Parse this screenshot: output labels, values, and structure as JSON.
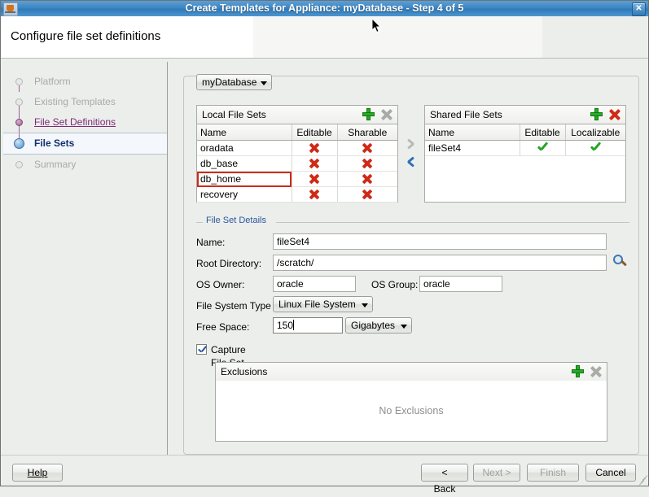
{
  "window": {
    "title": "Create Templates for Appliance: myDatabase - Step 4 of 5",
    "app_icon": "java-coffee-icon",
    "close_label": "✕"
  },
  "header": {
    "heading": "Configure file set definitions"
  },
  "sidebar": {
    "steps": [
      {
        "label": "Platform",
        "state": "disabled"
      },
      {
        "label": "Existing Templates",
        "state": "disabled"
      },
      {
        "label": "File Set Definitions",
        "state": "link"
      },
      {
        "label": "File Sets",
        "state": "active"
      },
      {
        "label": "Summary",
        "state": "disabled"
      }
    ]
  },
  "main": {
    "appliance_combo": {
      "value": "myDatabase"
    },
    "local_table": {
      "title": "Local File Sets",
      "add_icon": "plus-icon",
      "delete_icon": "delete-x-icon",
      "delete_enabled": "false",
      "columns": [
        "Name",
        "Editable",
        "Sharable"
      ],
      "rows": [
        {
          "name": "oradata",
          "editable": "x",
          "sharable": "x",
          "selected": "false"
        },
        {
          "name": "db_base",
          "editable": "x",
          "sharable": "x",
          "selected": "false"
        },
        {
          "name": "db_home",
          "editable": "x",
          "sharable": "x",
          "selected": "true"
        },
        {
          "name": "recovery",
          "editable": "x",
          "sharable": "x",
          "selected": "false"
        }
      ]
    },
    "transfer": {
      "to_shared_icon": "chevron-right-icon",
      "to_local_icon": "chevron-left-icon"
    },
    "shared_table": {
      "title": "Shared File Sets",
      "add_icon": "plus-icon",
      "delete_icon": "delete-x-icon",
      "delete_enabled": "true",
      "columns": [
        "Name",
        "Editable",
        "Localizable"
      ],
      "rows": [
        {
          "name": "fileSet4",
          "editable": "check",
          "localizable": "check"
        }
      ]
    },
    "details": {
      "group_title": "File Set Details",
      "name_label": "Name:",
      "name_value": "fileSet4",
      "root_label": "Root Directory:",
      "root_value": "/scratch/",
      "browse_icon": "magnifier-icon",
      "os_owner_label": "OS Owner:",
      "os_owner_value": "oracle",
      "os_group_label": "OS Group:",
      "os_group_value": "oracle",
      "fs_type_label": "File System Type",
      "fs_type_value": "Linux File System",
      "free_space_label": "Free Space:",
      "free_space_value": "150",
      "free_space_unit": "Gigabytes"
    },
    "capture": {
      "checkbox_label": "Capture File Set",
      "checked": "true"
    },
    "exclusions": {
      "title": "Exclusions",
      "add_icon": "plus-icon",
      "delete_icon": "delete-x-icon",
      "empty_text": "No Exclusions"
    }
  },
  "footer": {
    "help": "Help",
    "back": "< Back",
    "next": "Next >",
    "finish": "Finish",
    "cancel": "Cancel"
  },
  "colors": {
    "titlebar": "#3d86c4",
    "accent_link": "#7d2a77",
    "active_step": "#12306e",
    "error_red": "#cf2a17",
    "ok_green": "#25a425",
    "group_title": "#2a56a0"
  }
}
